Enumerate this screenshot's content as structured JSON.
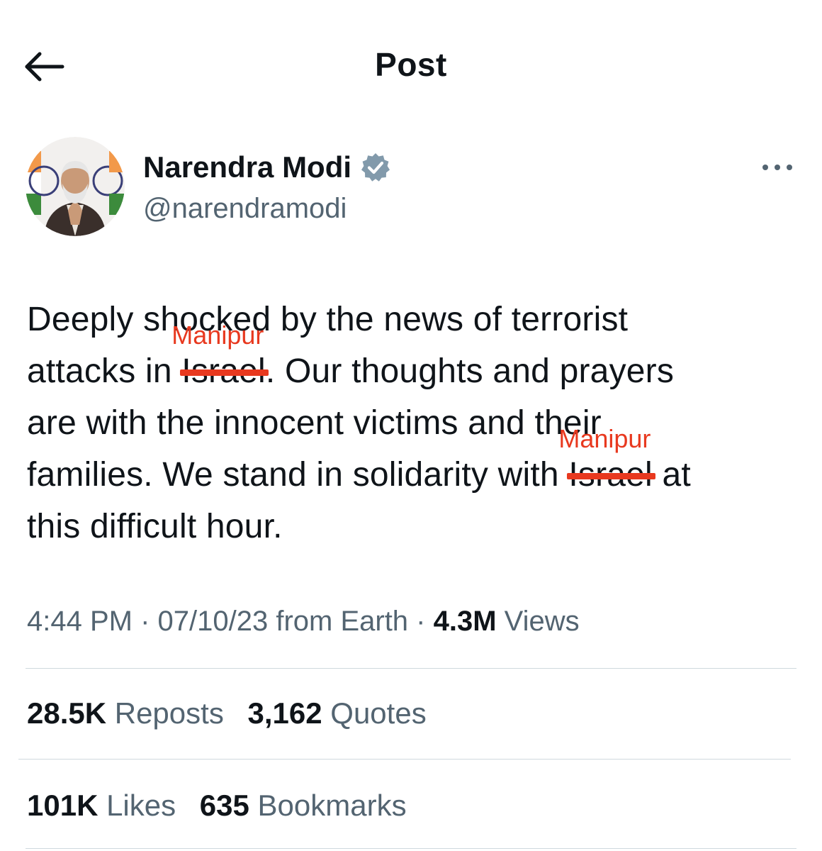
{
  "header": {
    "title": "Post",
    "back_icon": "arrow-left-icon"
  },
  "author": {
    "display_name": "Narendra Modi",
    "handle": "@narendramodi",
    "verified_color": "#829aab",
    "verified_icon": "verified-badge-icon",
    "more_icon": "more-horizontal-icon"
  },
  "post": {
    "line1_a": "Deeply shocked by the news of terrorist",
    "line2_a": "attacks in ",
    "edit1_struck": "Israel",
    "edit1_overlay": "Manipur",
    "line2_b": ". Our thoughts and prayers",
    "line3": "are with the innocent victims and their",
    "line4_a": "families. We stand in solidarity with ",
    "edit2_struck": "Israel",
    "edit2_overlay": "Manipur",
    "line4_b": " at",
    "line5": "this difficult hour.",
    "edit_color": "#e8391f"
  },
  "meta": {
    "time": "4:44 PM",
    "sep1": " · ",
    "date": "07/10/23",
    "source": " from Earth",
    "sep2": " · ",
    "views_count": "4.3M",
    "views_label": " Views"
  },
  "stats": {
    "reposts_count": "28.5K",
    "reposts_label": " Reposts",
    "quotes_count": "3,162",
    "quotes_label": " Quotes",
    "likes_count": "101K",
    "likes_label": " Likes",
    "bookmarks_count": "635",
    "bookmarks_label": " Bookmarks"
  }
}
